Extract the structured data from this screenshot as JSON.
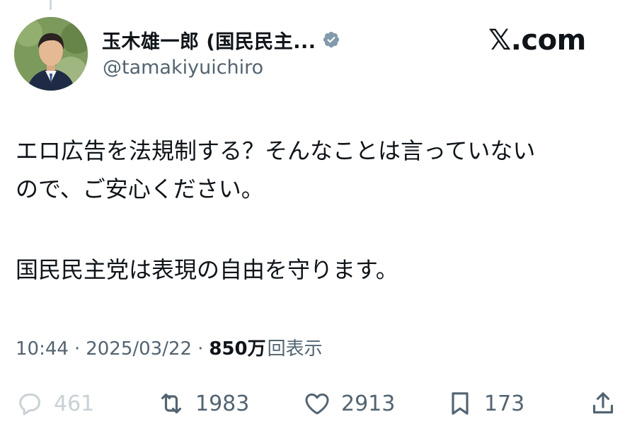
{
  "post": {
    "author": {
      "display_name": "玉木雄一郎 (国民民主...",
      "handle": "@tamakiyuichiro",
      "verified_color": "#829aab"
    },
    "brand": "𝕏.com",
    "text_lines": [
      "エロ広告を法規制する？そんなことは言っていない",
      "ので、ご安心ください。",
      "国民民主党は表現の自由を守ります。"
    ],
    "meta": {
      "time": "10:44",
      "separator": "·",
      "date": "2025/03/22",
      "views_count": "850万",
      "views_label": "回表示"
    },
    "actions": {
      "replies": "461",
      "reposts": "1983",
      "likes": "2913",
      "bookmarks": "173"
    }
  },
  "colors": {
    "text": "#0f1419",
    "secondary": "#536471",
    "faded": "#c9d1d6"
  }
}
